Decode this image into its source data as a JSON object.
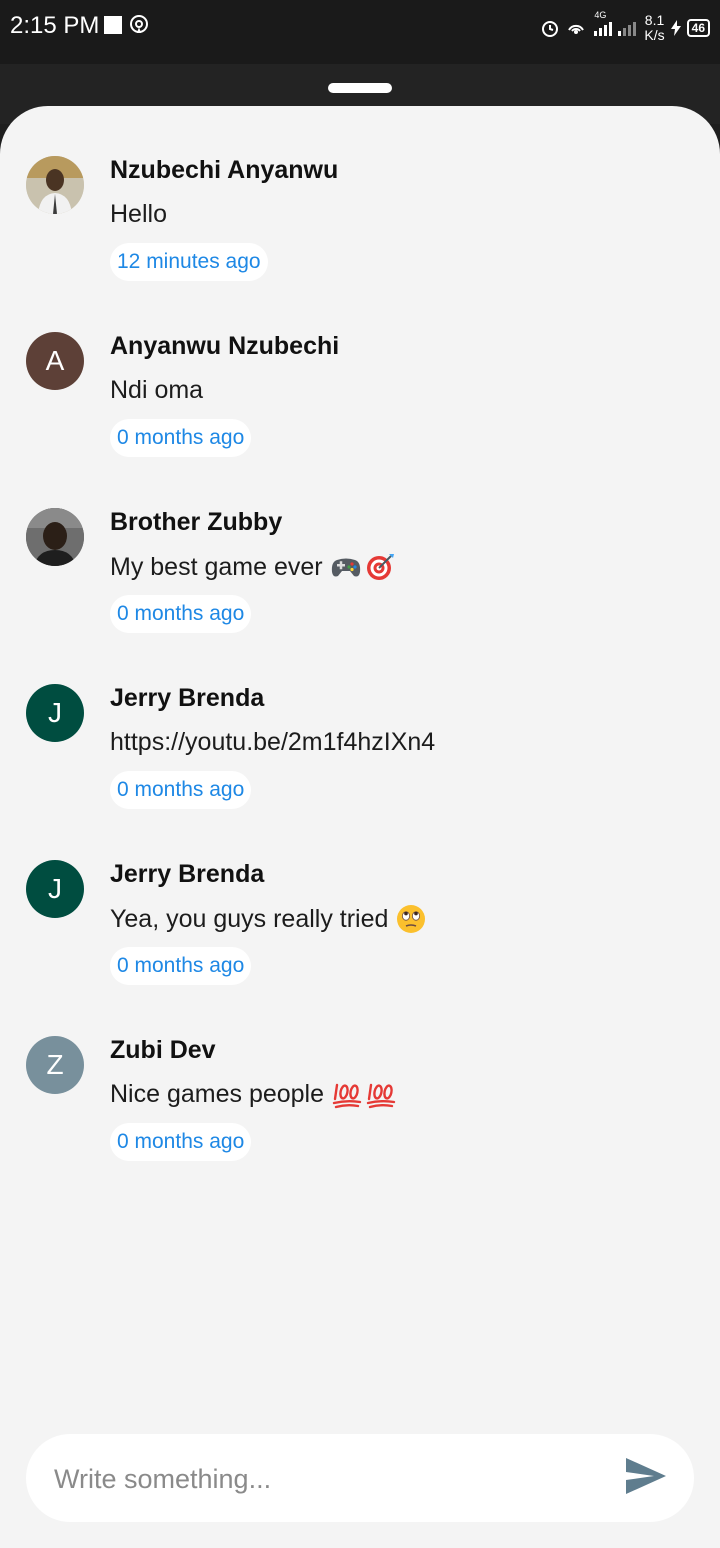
{
  "status_bar": {
    "time": "2:15 PM",
    "network_type": "4G",
    "net_speed_value": "8.1",
    "net_speed_unit": "K/s",
    "battery_level": "46"
  },
  "comments": [
    {
      "name": "Nzubechi Anyanwu",
      "text": "Hello",
      "time": "12 minutes ago",
      "avatar_type": "photo",
      "avatar_colors": [
        "#c8a66a",
        "#4a3b2a"
      ]
    },
    {
      "name": "Anyanwu Nzubechi",
      "text": "Ndi oma",
      "time": "0 months ago",
      "avatar_type": "letter",
      "avatar_letter": "A",
      "avatar_color": "#5d4037"
    },
    {
      "name": "Brother Zubby",
      "text": "My best game ever",
      "emoji": [
        "video-game-emoji",
        "direct-hit-emoji"
      ],
      "time": "0 months ago",
      "avatar_type": "photo",
      "avatar_colors": [
        "#6b6b6b",
        "#2b2018"
      ]
    },
    {
      "name": "Jerry Brenda",
      "text": "https://youtu.be/2m1f4hzIXn4",
      "time": "0 months ago",
      "avatar_type": "letter",
      "avatar_letter": "J",
      "avatar_color": "#004d40"
    },
    {
      "name": "Jerry Brenda",
      "text": "Yea, you guys really tried",
      "emoji": [
        "face-with-rolling-eyes-emoji"
      ],
      "time": "0 months ago",
      "avatar_type": "letter",
      "avatar_letter": "J",
      "avatar_color": "#004d40"
    },
    {
      "name": "Zubi Dev",
      "text": "Nice games people",
      "emoji": [
        "hundred-points-emoji",
        "hundred-points-emoji"
      ],
      "time": "0 months ago",
      "avatar_type": "letter",
      "avatar_letter": "Z",
      "avatar_color": "#78909c"
    }
  ],
  "input": {
    "placeholder": "Write something...",
    "send_icon": "send-icon",
    "send_color": "#5f7d8e"
  }
}
